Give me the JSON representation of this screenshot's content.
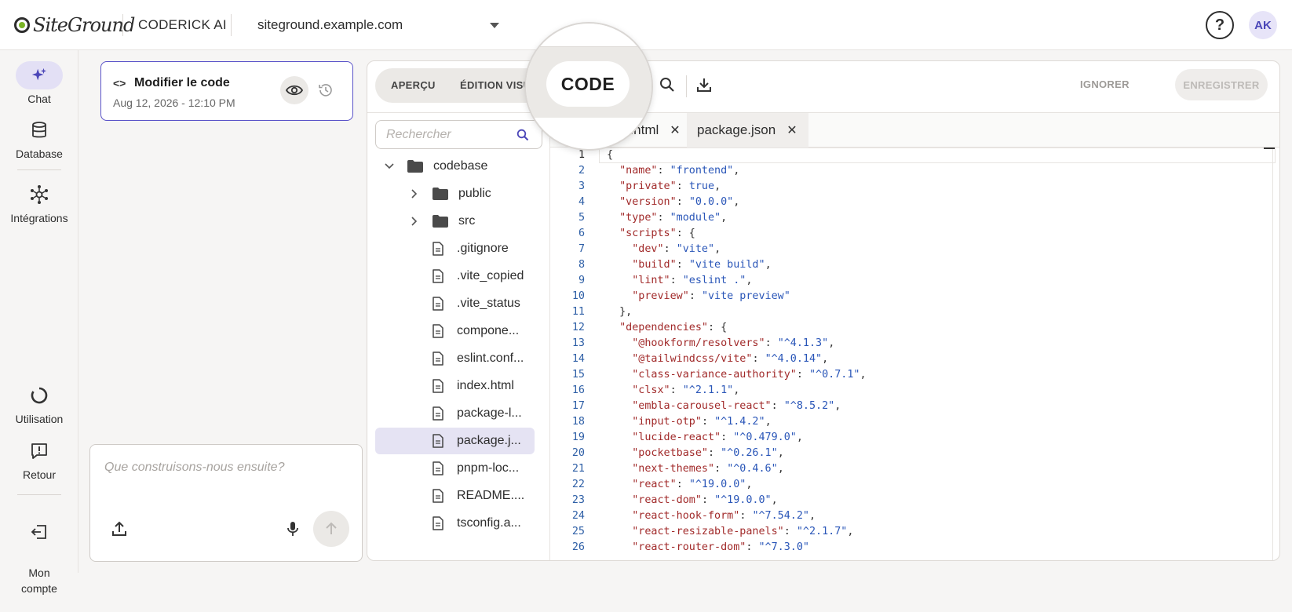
{
  "header": {
    "brand": "SiteGround",
    "app_name": "CODERICK AI",
    "site": "siteground.example.com",
    "help_label": "?",
    "avatar_initials": "AK"
  },
  "nav": {
    "items": [
      {
        "label": "Chat",
        "icon": "sparkle-icon"
      },
      {
        "label": "Database",
        "icon": "database-icon"
      },
      {
        "label": "Intégrations",
        "icon": "integrations-icon"
      },
      {
        "label": "Utilisation",
        "icon": "usage-icon"
      },
      {
        "label": "Retour",
        "icon": "feedback-icon"
      },
      {
        "label": "Mon\ncompte",
        "icon": "account-icon"
      }
    ]
  },
  "card": {
    "title": "Modifier le code",
    "date": "Aug 12, 2026 - 12:10 PM",
    "code_glyph": "<>"
  },
  "prompt": {
    "placeholder": "Que construisons-nous ensuite?"
  },
  "toolbar": {
    "tabs": [
      "APERÇU",
      "ÉDITION VISU",
      "CODE"
    ],
    "ignore_label": "IGNORER",
    "save_label": "ENREGISTRER"
  },
  "search": {
    "placeholder": "Rechercher"
  },
  "tree": [
    {
      "name": "codebase",
      "type": "folder",
      "depth": 0,
      "expanded": true
    },
    {
      "name": "public",
      "type": "folder",
      "depth": 1,
      "expanded": false
    },
    {
      "name": "src",
      "type": "folder",
      "depth": 1,
      "expanded": false
    },
    {
      "name": ".gitignore",
      "type": "file",
      "depth": 1
    },
    {
      "name": ".vite_copied",
      "type": "file",
      "depth": 1
    },
    {
      "name": ".vite_status",
      "type": "file",
      "depth": 1
    },
    {
      "name": "compone...",
      "type": "file",
      "depth": 1
    },
    {
      "name": "eslint.conf...",
      "type": "file",
      "depth": 1
    },
    {
      "name": "index.html",
      "type": "file",
      "depth": 1
    },
    {
      "name": "package-l...",
      "type": "file",
      "depth": 1
    },
    {
      "name": "package.j...",
      "type": "file",
      "depth": 1,
      "selected": true
    },
    {
      "name": "pnpm-loc...",
      "type": "file",
      "depth": 1
    },
    {
      "name": "README....",
      "type": "file",
      "depth": 1
    },
    {
      "name": "tsconfig.a...",
      "type": "file",
      "depth": 1
    }
  ],
  "file_tabs": [
    {
      "name": "...html",
      "active": false
    },
    {
      "name": "package.json",
      "active": true
    }
  ],
  "code_lines": [
    {
      "n": "1",
      "t": "{"
    },
    {
      "n": "2",
      "t": "  \"name\": \"frontend\","
    },
    {
      "n": "3",
      "t": "  \"private\": true,"
    },
    {
      "n": "4",
      "t": "  \"version\": \"0.0.0\","
    },
    {
      "n": "5",
      "t": "  \"type\": \"module\","
    },
    {
      "n": "6",
      "t": "  \"scripts\": {"
    },
    {
      "n": "7",
      "t": "    \"dev\": \"vite\","
    },
    {
      "n": "8",
      "t": "    \"build\": \"vite build\","
    },
    {
      "n": "9",
      "t": "    \"lint\": \"eslint .\","
    },
    {
      "n": "10",
      "t": "    \"preview\": \"vite preview\""
    },
    {
      "n": "11",
      "t": "  },"
    },
    {
      "n": "12",
      "t": "  \"dependencies\": {"
    },
    {
      "n": "13",
      "t": "    \"@hookform/resolvers\": \"^4.1.3\","
    },
    {
      "n": "14",
      "t": "    \"@tailwindcss/vite\": \"^4.0.14\","
    },
    {
      "n": "15",
      "t": "    \"class-variance-authority\": \"^0.7.1\","
    },
    {
      "n": "16",
      "t": "    \"clsx\": \"^2.1.1\","
    },
    {
      "n": "17",
      "t": "    \"embla-carousel-react\": \"^8.5.2\","
    },
    {
      "n": "18",
      "t": "    \"input-otp\": \"^1.4.2\","
    },
    {
      "n": "19",
      "t": "    \"lucide-react\": \"^0.479.0\","
    },
    {
      "n": "20",
      "t": "    \"pocketbase\": \"^0.26.1\","
    },
    {
      "n": "21",
      "t": "    \"next-themes\": \"^0.4.6\","
    },
    {
      "n": "22",
      "t": "    \"react\": \"^19.0.0\","
    },
    {
      "n": "23",
      "t": "    \"react-dom\": \"^19.0.0\","
    },
    {
      "n": "24",
      "t": "    \"react-hook-form\": \"^7.54.2\","
    },
    {
      "n": "25",
      "t": "    \"react-resizable-panels\": \"^2.1.7\","
    },
    {
      "n": "26",
      "t": "    \"react-router-dom\": \"^7.3.0\""
    }
  ],
  "colors": {
    "accent": "#5a53c9",
    "key": "#a12a2a",
    "string": "#2a56b8",
    "line_number": "#2e5fa6"
  }
}
